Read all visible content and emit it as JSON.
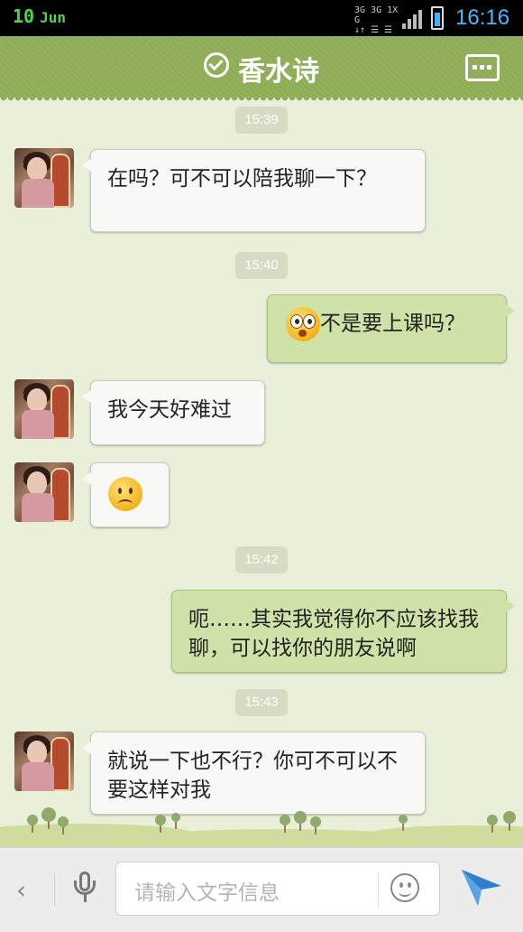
{
  "status_bar": {
    "day": "10",
    "month": "Jun",
    "network": [
      "3G 3G 1X G",
      "↓↑ ☰ ☰"
    ],
    "time": "16:16"
  },
  "header": {
    "title": "香水诗"
  },
  "messages": [
    {
      "type": "time",
      "text": "15:39"
    },
    {
      "type": "in",
      "text": "在吗？可不可以陪我聊一下？"
    },
    {
      "type": "time",
      "text": "15:40"
    },
    {
      "type": "out",
      "text": "不是要上课吗？",
      "emoji": "shocked-emoji"
    },
    {
      "type": "in",
      "text": "我今天好难过"
    },
    {
      "type": "in",
      "emoji": "sad-emoji"
    },
    {
      "type": "time",
      "text": "15:42"
    },
    {
      "type": "out",
      "text": "呃……其实我觉得你不应该找我聊，可以找你的朋友说啊"
    },
    {
      "type": "time",
      "text": "15:43"
    },
    {
      "type": "in",
      "text": "就说一下也不行？你可不可以不要这样对我"
    }
  ],
  "input_bar": {
    "back_label": "‹",
    "placeholder": "请输入文字信息"
  },
  "colors": {
    "header": "#8fad56",
    "background": "#e9efd9",
    "outgoing_bubble": "#cfe2a7",
    "incoming_bubble": "#f8f8f6",
    "timestamp": "#d4dcc4"
  }
}
